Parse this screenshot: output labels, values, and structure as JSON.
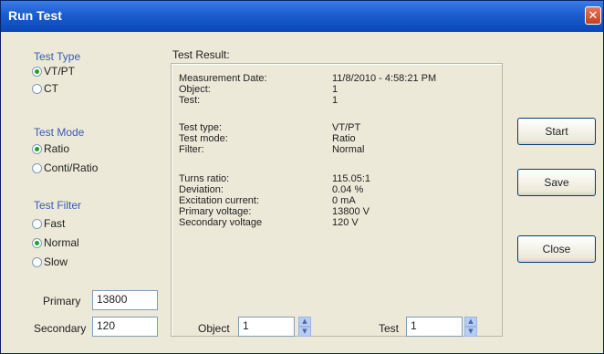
{
  "window": {
    "title": "Run Test",
    "close_glyph": "✕"
  },
  "test_type": {
    "label": "Test Type",
    "options": [
      "VT/PT",
      "CT"
    ],
    "selected": 0
  },
  "test_mode": {
    "label": "Test Mode",
    "options": [
      "Ratio",
      "Conti/Ratio"
    ],
    "selected": 0
  },
  "test_filter": {
    "label": "Test Filter",
    "options": [
      "Fast",
      "Normal",
      "Slow"
    ],
    "selected": 1
  },
  "result": {
    "label": "Test Result:",
    "rows": [
      {
        "key": "Measurement Date:",
        "value": "11/8/2010 - 4:58:21 PM"
      },
      {
        "key": "Object:",
        "value": "1"
      },
      {
        "key": "Test:",
        "value": "1"
      },
      {
        "key": "Test type:",
        "value": "VT/PT"
      },
      {
        "key": "Test mode:",
        "value": "Ratio"
      },
      {
        "key": "Filter:",
        "value": "Normal"
      },
      {
        "key": "Turns ratio:",
        "value": "115.05:1"
      },
      {
        "key": "Deviation:",
        "value": "0.04 %"
      },
      {
        "key": "Excitation current:",
        "value": "0 mA"
      },
      {
        "key": "Primary voltage:",
        "value": "13800 V"
      },
      {
        "key": "Secondary voltage",
        "value": "120 V"
      }
    ]
  },
  "buttons": {
    "start": "Start",
    "save": "Save",
    "close": "Close"
  },
  "fields": {
    "primary": {
      "label": "Primary",
      "value": "13800"
    },
    "secondary": {
      "label": "Secondary",
      "value": "120"
    },
    "object": {
      "label": "Object",
      "value": "1"
    },
    "test": {
      "label": "Test",
      "value": "1"
    }
  }
}
